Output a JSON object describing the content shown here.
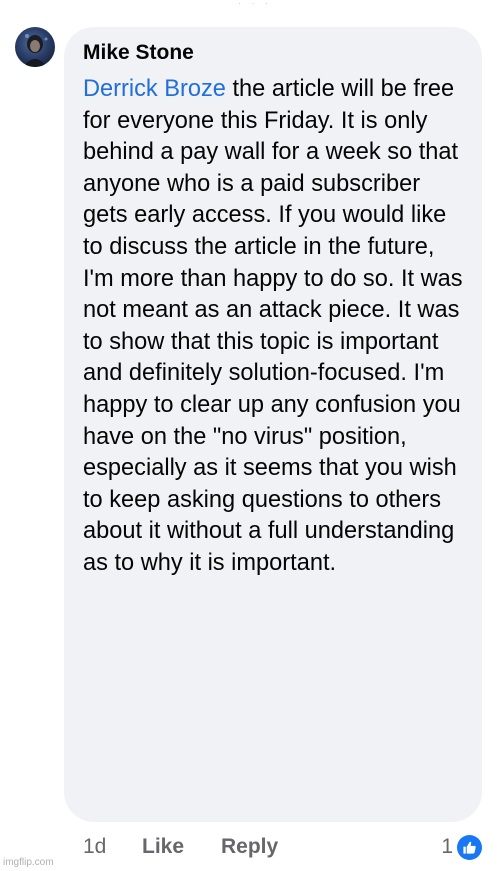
{
  "comment": {
    "author": "Mike Stone",
    "mention": "Derrick Broze",
    "text": " the article will be free for everyone this Friday. It is only behind a pay wall for a week so that anyone who is a paid subscriber gets early access. If you would like to discuss the article in the future, I'm more than happy to do so. It was not meant as an attack piece. It was to show that this topic is important and definitely solution-focused. I'm happy to clear up any confusion you have on the \"no virus\" position, especially as it seems that you wish to keep asking questions to others about it without a full understanding as to why it is important.",
    "timestamp": "1d",
    "like_label": "Like",
    "reply_label": "Reply",
    "reaction_count": "1",
    "reaction_icon": "thumbs-up-icon"
  },
  "watermark": "imgflip.com",
  "colors": {
    "bubble_bg": "#f0f2f5",
    "mention": "#216fdb",
    "meta_text": "#65676b",
    "reaction_blue": "#1877f2"
  }
}
